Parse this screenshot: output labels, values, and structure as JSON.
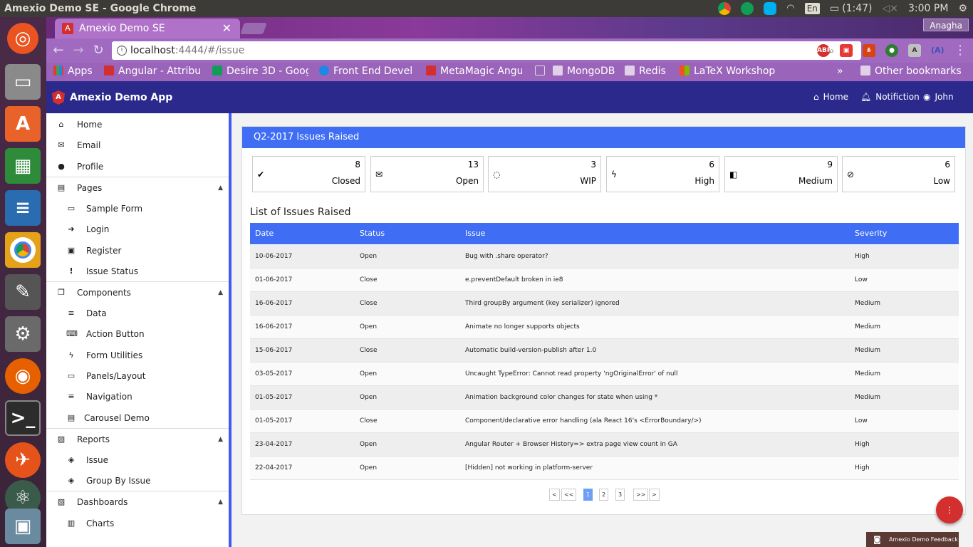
{
  "os": {
    "window_title": "Amexio Demo SE - Google Chrome",
    "battery": "(1:47)",
    "keyboard": "En",
    "clock": "3:00 PM"
  },
  "browser": {
    "tab_title": "Amexio Demo SE",
    "profile": "Anagha",
    "url_host": "localhost",
    "url_path": ":4444/#/issue",
    "bookmarks": [
      "Apps",
      "Angular - Attribu",
      "Desire 3D - Goog",
      "Front End Devel",
      "MetaMagic Angu",
      "MongoDB",
      "Redis",
      "LaTeX Workshop"
    ],
    "more": "»",
    "other_bookmarks": "Other bookmarks"
  },
  "app": {
    "brand": "Amexio Demo App",
    "nav": {
      "home": "Home",
      "notification": "Notifiction",
      "user": "John Doe"
    }
  },
  "sidebar": {
    "items": [
      {
        "label": "Home",
        "icon": "home-icon"
      },
      {
        "label": "Email",
        "icon": "envelope-icon"
      },
      {
        "label": "Profile",
        "icon": "user-icon"
      },
      {
        "label": "Pages",
        "icon": "pages-icon"
      },
      {
        "label": "Sample Form",
        "icon": "laptop-icon"
      },
      {
        "label": "Login",
        "icon": "login-icon"
      },
      {
        "label": "Register",
        "icon": "register-icon"
      },
      {
        "label": "Issue Status",
        "icon": "exclamation-icon"
      },
      {
        "label": "Components",
        "icon": "components-icon"
      },
      {
        "label": "Data",
        "icon": "database-icon"
      },
      {
        "label": "Action Button",
        "icon": "keyboard-icon"
      },
      {
        "label": "Form Utilities",
        "icon": "bolt-icon"
      },
      {
        "label": "Panels/Layout",
        "icon": "desktop-icon"
      },
      {
        "label": "Navigation",
        "icon": "bars-icon"
      },
      {
        "label": "Carousel Demo",
        "icon": "carousel-icon"
      },
      {
        "label": "Reports",
        "icon": "image-icon"
      },
      {
        "label": "Issue",
        "icon": "eraser-icon"
      },
      {
        "label": "Group By Issue",
        "icon": "eraser-icon"
      },
      {
        "label": "Dashboards",
        "icon": "image-icon"
      },
      {
        "label": "Charts",
        "icon": "chart-icon"
      }
    ]
  },
  "panel": {
    "title": "Q2-2017 Issues Raised",
    "cards": [
      {
        "value": "8",
        "label": "Closed",
        "icon": "check-icon"
      },
      {
        "value": "13",
        "label": "Open",
        "icon": "envelope-open-icon"
      },
      {
        "value": "3",
        "label": "WIP",
        "icon": "spinner-icon"
      },
      {
        "value": "6",
        "label": "High",
        "icon": "bolt-icon"
      },
      {
        "value": "9",
        "label": "Medium",
        "icon": "map-icon"
      },
      {
        "value": "6",
        "label": "Low",
        "icon": "eye-slash-icon"
      }
    ],
    "list_title": "List of Issues Raised",
    "columns": [
      "Date",
      "Status",
      "Issue",
      "Severity"
    ],
    "rows": [
      [
        "10-06-2017",
        "Open",
        "Bug with .share operator?",
        "High"
      ],
      [
        "01-06-2017",
        "Close",
        "e.preventDefault broken in ie8",
        "Low"
      ],
      [
        "16-06-2017",
        "Close",
        "Third groupBy argument (key serializer) ignored",
        "Medium"
      ],
      [
        "16-06-2017",
        "Open",
        "Animate no longer supports objects",
        "Medium"
      ],
      [
        "15-06-2017",
        "Close",
        "Automatic build-version-publish after 1.0",
        "Medium"
      ],
      [
        "03-05-2017",
        "Open",
        "Uncaught TypeError: Cannot read property 'ngOriginalError' of null",
        "Medium"
      ],
      [
        "01-05-2017",
        "Open",
        "Animation background color changes for state when using *",
        "Medium"
      ],
      [
        "01-05-2017",
        "Close",
        "Component/declarative error handling (ala React 16's <ErrorBoundary/>)",
        "Low"
      ],
      [
        "23-04-2017",
        "Open",
        "Angular Router + Browser History=> extra page view count in GA",
        "High"
      ],
      [
        "22-04-2017",
        "Open",
        "[Hidden] not working in platform-server",
        "High"
      ]
    ],
    "pager": [
      "<",
      "<<",
      "1",
      "2",
      "3",
      ">>",
      ">"
    ],
    "current_page": "1"
  },
  "feedback": "Amexio Demo Feedback"
}
